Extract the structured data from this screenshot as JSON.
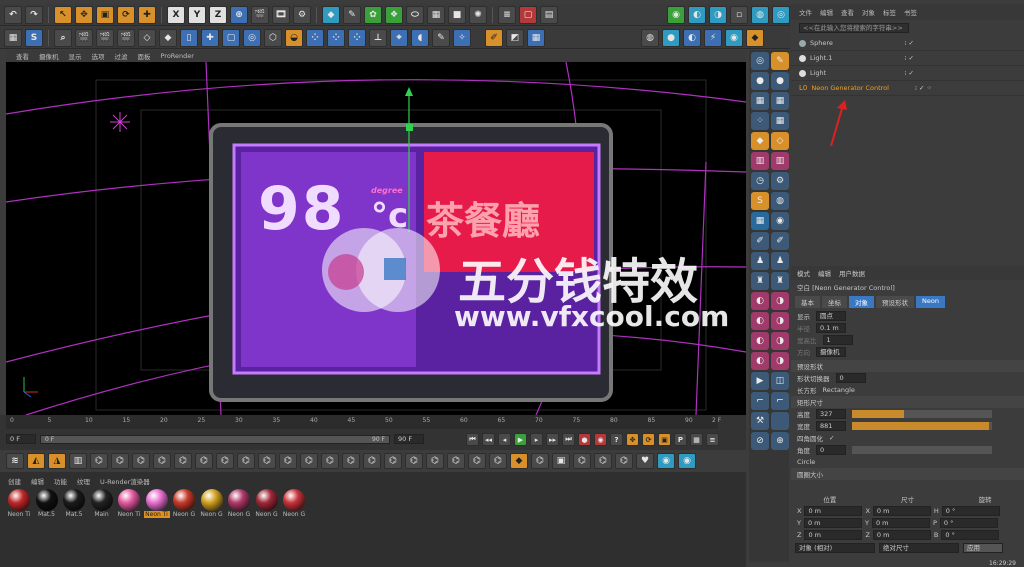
{
  "top_toolbar": {
    "labels": [
      "X",
      "Y",
      "Z"
    ]
  },
  "viewport_menu": [
    "查看",
    "摄像机",
    "显示",
    "选项",
    "过滤",
    "面板",
    "ProRender"
  ],
  "viewport": {
    "sign_text_number": "98",
    "sign_text_unit": "°c",
    "sign_text_small": "degree",
    "sign_chinese": "茶餐廳",
    "watermark_cn": "五分钱特效",
    "watermark_url": "www.vfxcool.com"
  },
  "timeline": {
    "ticks": [
      "0",
      "5",
      "10",
      "15",
      "20",
      "25",
      "30",
      "35",
      "40",
      "45",
      "50",
      "55",
      "60",
      "65",
      "70",
      "75",
      "80",
      "85",
      "90"
    ],
    "end_label": "2 F",
    "start_field": "0 F",
    "current_field": "0 F",
    "max_field": "90 F",
    "end_field": "90 F"
  },
  "materials": {
    "menu": [
      "创建",
      "编辑",
      "功能",
      "纹理",
      "U-Render渲染器"
    ],
    "items": [
      {
        "name": "Neon Ti",
        "color": "#c0282a"
      },
      {
        "name": "Mat.5",
        "color": "#111111"
      },
      {
        "name": "Mat.5",
        "color": "#1a1a1a"
      },
      {
        "name": "Main",
        "color": "#222222"
      },
      {
        "name": "Neon Ti",
        "color": "#e35aa0"
      },
      {
        "name": "Neon Ti",
        "color": "#e86fd0"
      },
      {
        "name": "Neon G",
        "color": "#c83a2a"
      },
      {
        "name": "Neon G",
        "color": "#d0a020"
      },
      {
        "name": "Neon G",
        "color": "#b03a6a"
      },
      {
        "name": "Neon G",
        "color": "#a02838"
      },
      {
        "name": "Neon G",
        "color": "#c8343a"
      }
    ]
  },
  "object_manager": {
    "menu": [
      "文件",
      "编辑",
      "查看",
      "对象",
      "标签",
      "书签"
    ],
    "search_hint": "<<在此输入您将搜索的字符串>>",
    "objects": [
      {
        "name": "Sphere"
      },
      {
        "name": "Light.1"
      },
      {
        "name": "Light"
      },
      {
        "name": "Neon Generator Control"
      }
    ]
  },
  "attributes": {
    "menu": [
      "模式",
      "编辑",
      "用户数据"
    ],
    "title": "空白 [Neon Generator Control]",
    "tabs": [
      "基本",
      "坐标",
      "对象",
      "预设形状",
      "Neon"
    ],
    "active_tab": "对象",
    "display_label": "显示",
    "display_value": "圆点",
    "radius_label": "半径",
    "radius_value": "0.1 m",
    "aspect_label": "宽高比",
    "aspect_value": "1",
    "orient_label": "方向",
    "orient_value": "摄像机",
    "preset_section": "预设形状",
    "shape_rev_label": "形状切换器",
    "shape_rev_value": "0",
    "shape_label": "长方形",
    "shape_value": "Rectangle",
    "rect_section": "矩形尺寸",
    "height_label": "高度",
    "height_value": "327",
    "height_fill": 0.37,
    "width_label": "宽度",
    "width_value": "881",
    "width_fill": 0.98,
    "round_label": "四角圆化",
    "round_check": "✓",
    "corner_label": "角度",
    "corner_value": "0",
    "circle_label": "Circle",
    "circle_section": "圆圈大小"
  },
  "coords": {
    "headers": [
      "位置",
      "尺寸",
      "旋转"
    ],
    "rows": [
      {
        "axis": "X",
        "pos": "0 m",
        "size_axis": "X",
        "size": "0 m",
        "rot_axis": "H",
        "rot": "0 °"
      },
      {
        "axis": "Y",
        "pos": "0 m",
        "size_axis": "Y",
        "size": "0 m",
        "rot_axis": "P",
        "rot": "0 °"
      },
      {
        "axis": "Z",
        "pos": "0 m",
        "size_axis": "Z",
        "size": "0 m",
        "rot_axis": "B",
        "rot": "0 °"
      }
    ],
    "mode1": "对象 (相对)",
    "mode2": "绝对尺寸",
    "apply": "应用"
  },
  "taskbar_time": "16:29:29"
}
